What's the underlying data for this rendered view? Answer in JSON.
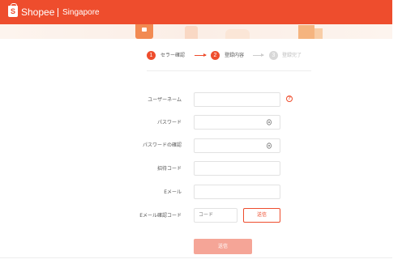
{
  "header": {
    "logo_letter": "S",
    "brand": "Shopee",
    "region": "Singapore",
    "color": "#ee4d2d"
  },
  "steps": [
    {
      "number": "1",
      "label": "セラー確認",
      "state": "done"
    },
    {
      "number": "2",
      "label": "登録内容",
      "state": "active"
    },
    {
      "number": "3",
      "label": "登録完了",
      "state": "pending"
    }
  ],
  "form": {
    "username": {
      "label": "ユーザーネーム",
      "value": "",
      "placeholder": ""
    },
    "password": {
      "label": "パスワード",
      "value": "",
      "placeholder": ""
    },
    "password_confirm": {
      "label": "パスワードの確認",
      "value": "",
      "placeholder": ""
    },
    "invite_code": {
      "label": "招待コード",
      "value": "",
      "placeholder": ""
    },
    "email": {
      "label": "Eメール",
      "value": "",
      "placeholder": ""
    },
    "email_code": {
      "label": "Eメール確認コード",
      "placeholder": "コード",
      "send_label": "送信"
    },
    "submit_label": "送信"
  },
  "icons": {
    "help": "help-circle-icon",
    "password_visibility": "eye-icon"
  },
  "colors": {
    "accent": "#ee4d2d",
    "submit_disabled": "#f5a597",
    "step_pending": "#d8d8d8"
  }
}
